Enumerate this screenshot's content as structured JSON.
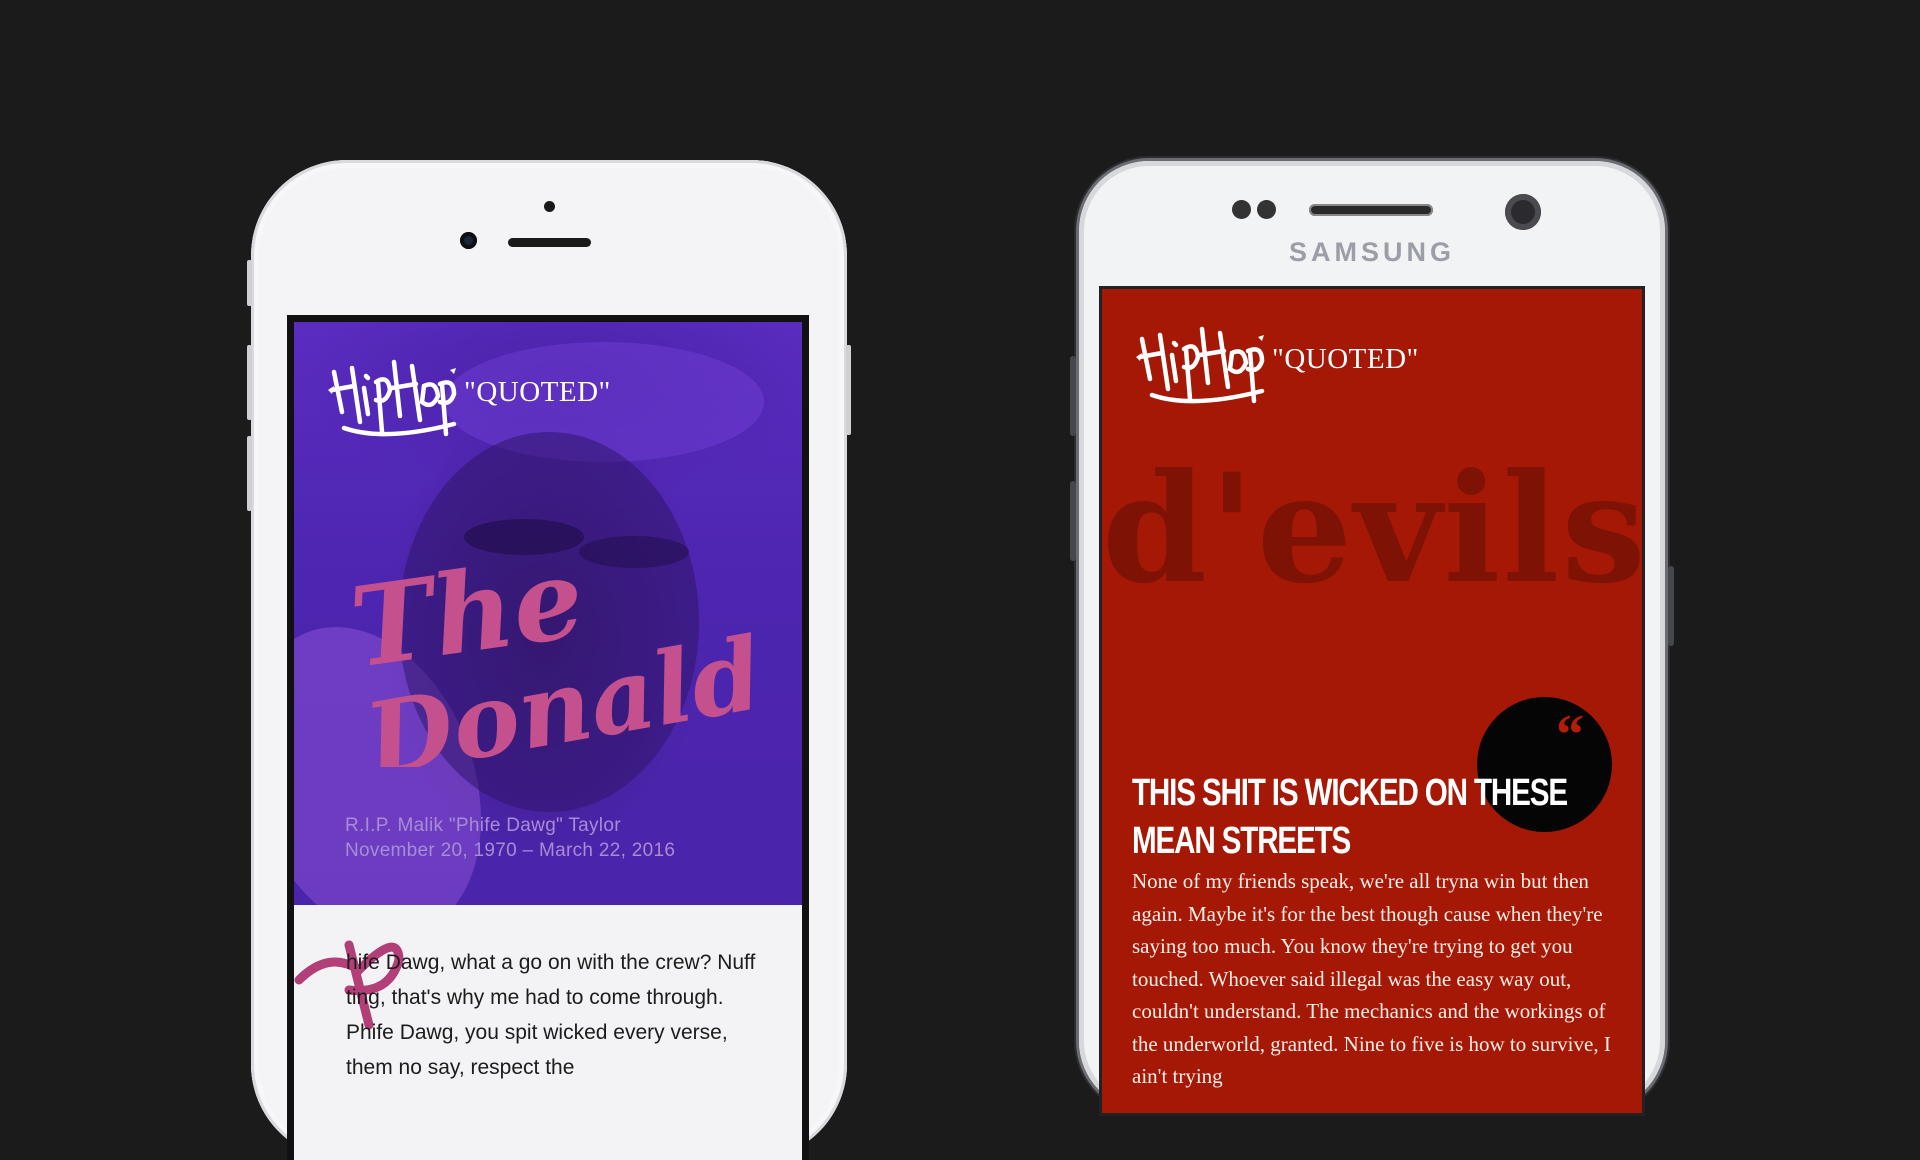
{
  "iphone": {
    "brand_logo": "HipHop",
    "logo_suffix": "\"QUOTED\"",
    "hero_title": "The Donald",
    "rip_line1": "R.I.P. Malik \"Phife Dawg\" Taylor",
    "rip_line2": "November 20, 1970 – March 22, 2016",
    "drop_cap": "P",
    "body_text": "hife Dawg, what a go on with the crew? Nuff ting, that's why me had to come through. Phife Dawg, you spit wicked every verse, them no say, respect the"
  },
  "samsung": {
    "brand": "SAMSUNG",
    "brand_logo": "HipHop",
    "logo_suffix": "\"QUOTED\"",
    "featured_word": "d'evils",
    "quote_mark": "“",
    "headline": "THIS SHIT IS WICKED ON THESE MEAN STREETS",
    "body_text": "None of my friends speak, we're all tryna win but then again. Maybe it's for the best though cause when they're saying too much. You know they're trying to get you touched. Whoever said illegal was the easy way out, couldn't understand. The mechanics and the workings of the underworld, granted. Nine to five is how to survive, I ain't trying"
  },
  "colors": {
    "background": "#1b1b1b",
    "iphone_hero": "#5a2cc0",
    "iphone_title": "#c4508e",
    "samsung_screen": "#a51806",
    "samsung_word": "#7e1205"
  }
}
